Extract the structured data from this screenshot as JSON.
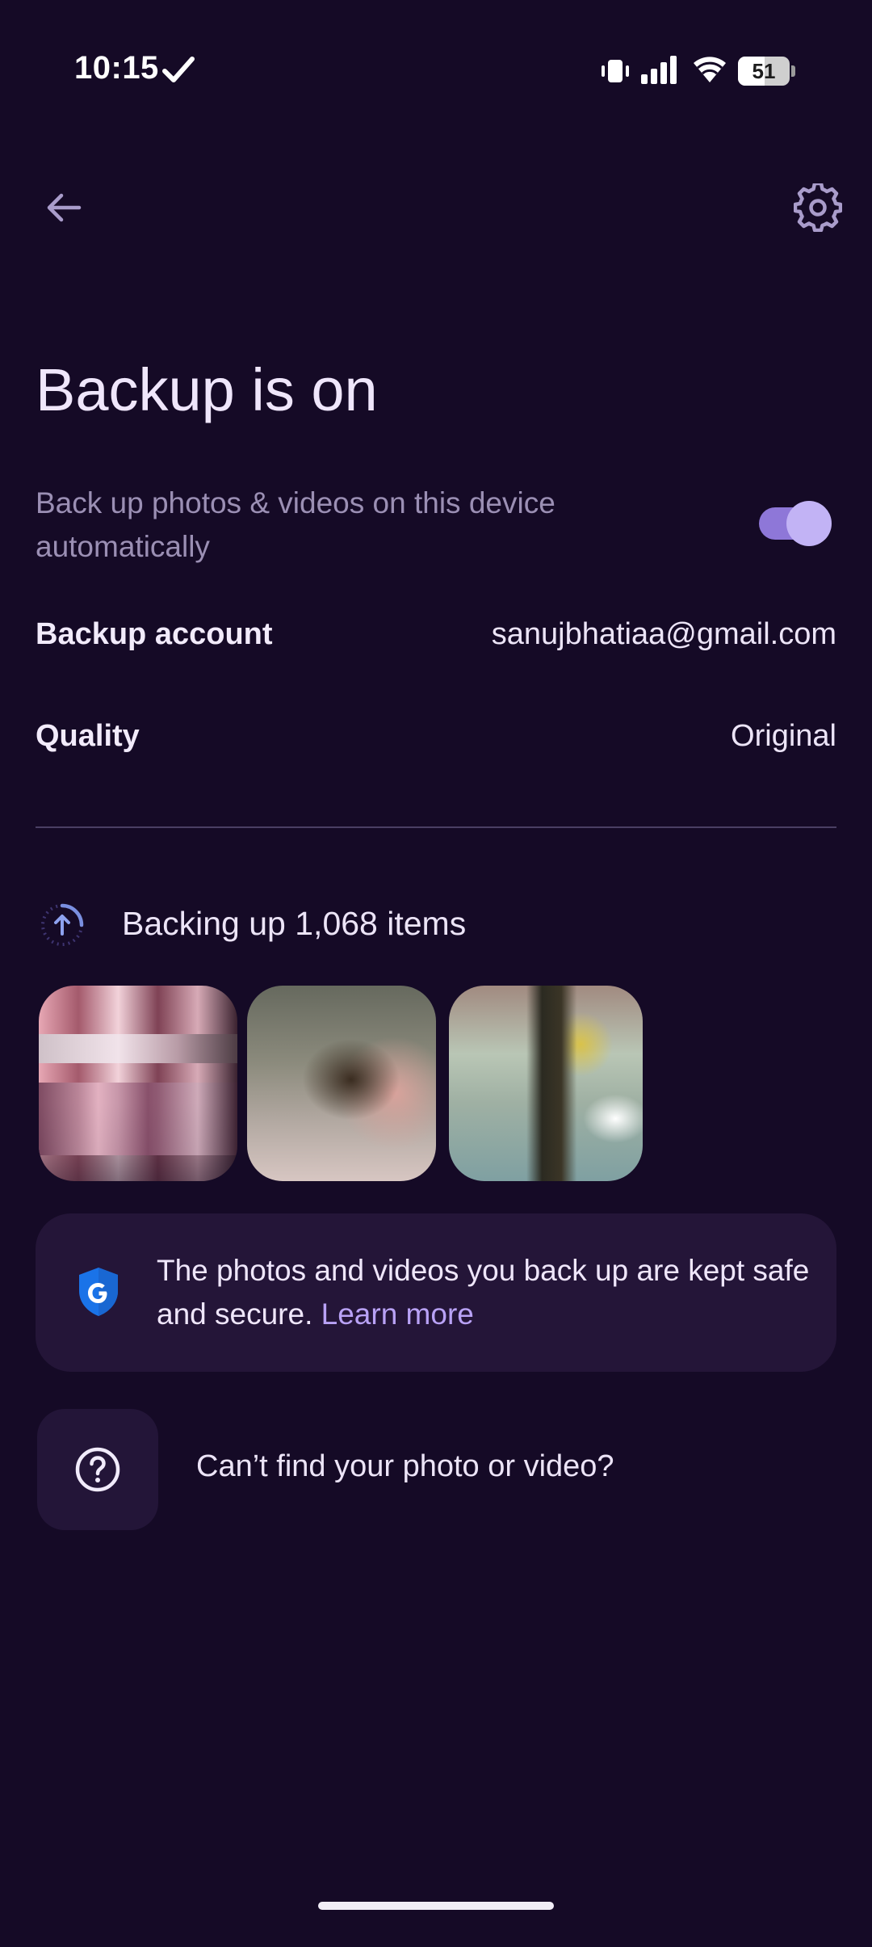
{
  "status_bar": {
    "time": "10:15",
    "battery_level": "51"
  },
  "header": {
    "title": "Backup is on"
  },
  "auto_backup": {
    "description": "Back up photos & videos on this device automatically",
    "enabled": true
  },
  "settings_rows": [
    {
      "label": "Backup account",
      "value": "sanujbhatiaa@gmail.com"
    },
    {
      "label": "Quality",
      "value": "Original"
    }
  ],
  "progress": {
    "text": "Backing up 1,068 items"
  },
  "info_card": {
    "text": "The photos and videos you back up are kept safe and secure. ",
    "link": "Learn more"
  },
  "help": {
    "text": "Can’t find your photo or video?"
  },
  "icons": {
    "back": "arrow-back-icon",
    "settings": "gear-icon",
    "shield": "google-shield-icon",
    "help": "question-circle-icon",
    "progress": "upload-progress-icon"
  },
  "colors": {
    "background": "#150a26",
    "accent": "#b9a2f6",
    "card": "#241538"
  }
}
